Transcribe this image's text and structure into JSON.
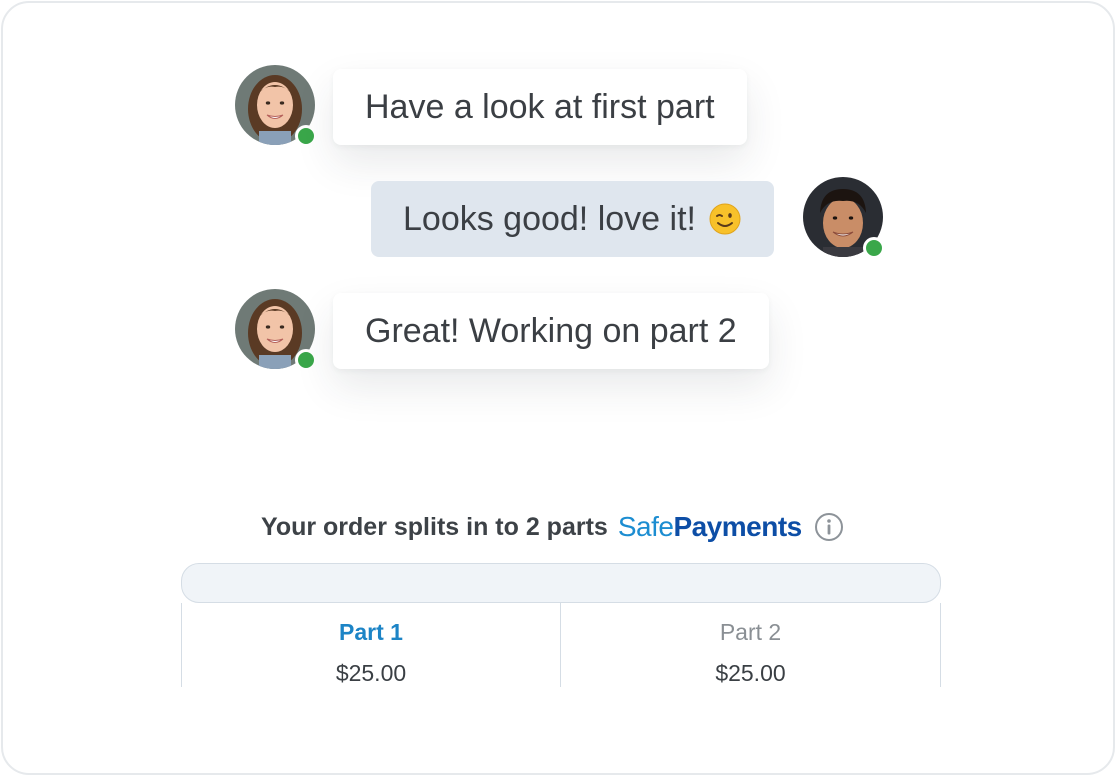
{
  "chat": {
    "messages": [
      {
        "text": "Have a look at first part",
        "direction": "incoming",
        "avatar": "woman-avatar",
        "status": "online"
      },
      {
        "text": "Looks good! love it!",
        "emoji": "winking-face-icon",
        "direction": "outgoing",
        "avatar": "man-avatar",
        "status": "online"
      },
      {
        "text": "Great! Working on part 2",
        "direction": "incoming",
        "avatar": "woman-avatar",
        "status": "online"
      }
    ]
  },
  "split": {
    "title": "Your order splits in to 2 parts",
    "brand_part1": "Safe",
    "brand_part2": "Payments",
    "info_icon": "info-icon",
    "parts": [
      {
        "label": "Part 1",
        "amount": "$25.00",
        "active": true
      },
      {
        "label": "Part 2",
        "amount": "$25.00",
        "active": false
      }
    ]
  },
  "colors": {
    "online": "#3aa74a",
    "accent": "#1c84c6",
    "brand_light": "#1c8dd1",
    "brand_dark": "#0d4ea6",
    "outgoing_bubble": "#dfe6ee"
  }
}
